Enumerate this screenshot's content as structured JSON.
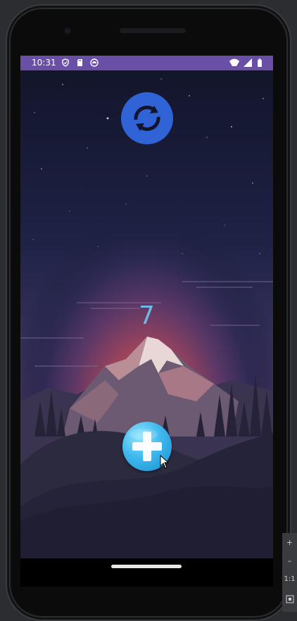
{
  "status_bar": {
    "time": "10:31",
    "left_icons": [
      "shield-icon",
      "sd-card-icon",
      "android-icon"
    ],
    "right_icons": [
      "wifi-icon",
      "cellular-signal-icon",
      "battery-icon"
    ],
    "color": "#6a4fa6"
  },
  "app": {
    "counter_value": "7",
    "refresh_button_icon": "refresh-icon",
    "add_button_icon": "plus-icon",
    "accent_blue": "#2f63d6",
    "counter_color": "#6fb7e6"
  },
  "emulator_controls": {
    "zoom_in_label": "+",
    "zoom_out_label": "–",
    "actual_size_label": "1:1"
  }
}
